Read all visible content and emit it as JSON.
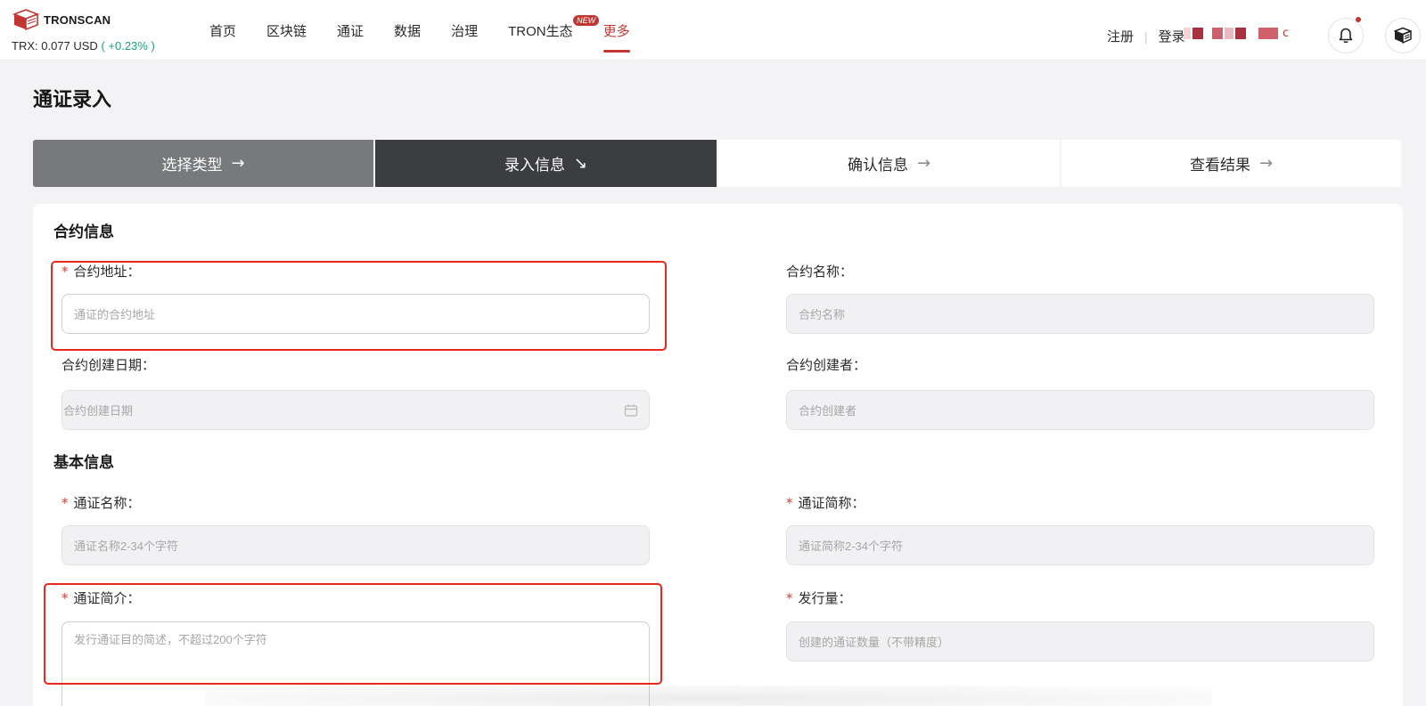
{
  "header": {
    "logo_text": "TRONSCAN",
    "price_text": "TRX: 0.077 USD",
    "price_change": "( +0.23% )",
    "nav": [
      {
        "label": "首页"
      },
      {
        "label": "区块链"
      },
      {
        "label": "通证"
      },
      {
        "label": "数据"
      },
      {
        "label": "治理"
      },
      {
        "label": "TRON生态",
        "badge": "NEW"
      },
      {
        "label": "更多"
      }
    ],
    "register": "注册",
    "login": "登录",
    "lang_suffix": "c"
  },
  "page": {
    "title": "通证录入",
    "steps": [
      {
        "label": "选择类型",
        "arrow": "→"
      },
      {
        "label": "录入信息",
        "arrow": "↘"
      },
      {
        "label": "确认信息",
        "arrow": "→"
      },
      {
        "label": "查看结果",
        "arrow": "→"
      }
    ]
  },
  "form": {
    "contract_section": "合约信息",
    "basic_section": "基本信息",
    "required_mark": "*",
    "contract_address": {
      "label": "合约地址：",
      "placeholder": "通证的合约地址"
    },
    "contract_name": {
      "label": "合约名称：",
      "placeholder": "合约名称"
    },
    "contract_date": {
      "label": "合约创建日期：",
      "placeholder": "合约创建日期"
    },
    "contract_creator": {
      "label": "合约创建者：",
      "placeholder": "合约创建者"
    },
    "token_name": {
      "label": "通证名称：",
      "placeholder": "通证名称2-34个字符"
    },
    "token_abbr": {
      "label": "通证简称：",
      "placeholder": "通证简称2-34个字符"
    },
    "token_desc": {
      "label": "通证简介：",
      "placeholder": "发行通证目的简述，不超过200个字符"
    },
    "token_supply": {
      "label": "发行量：",
      "placeholder": "创建的通证数量（不带精度）"
    }
  },
  "colors": {
    "accent": "#c23631",
    "highlight": "#e8271d",
    "positive": "#1aa37a"
  }
}
